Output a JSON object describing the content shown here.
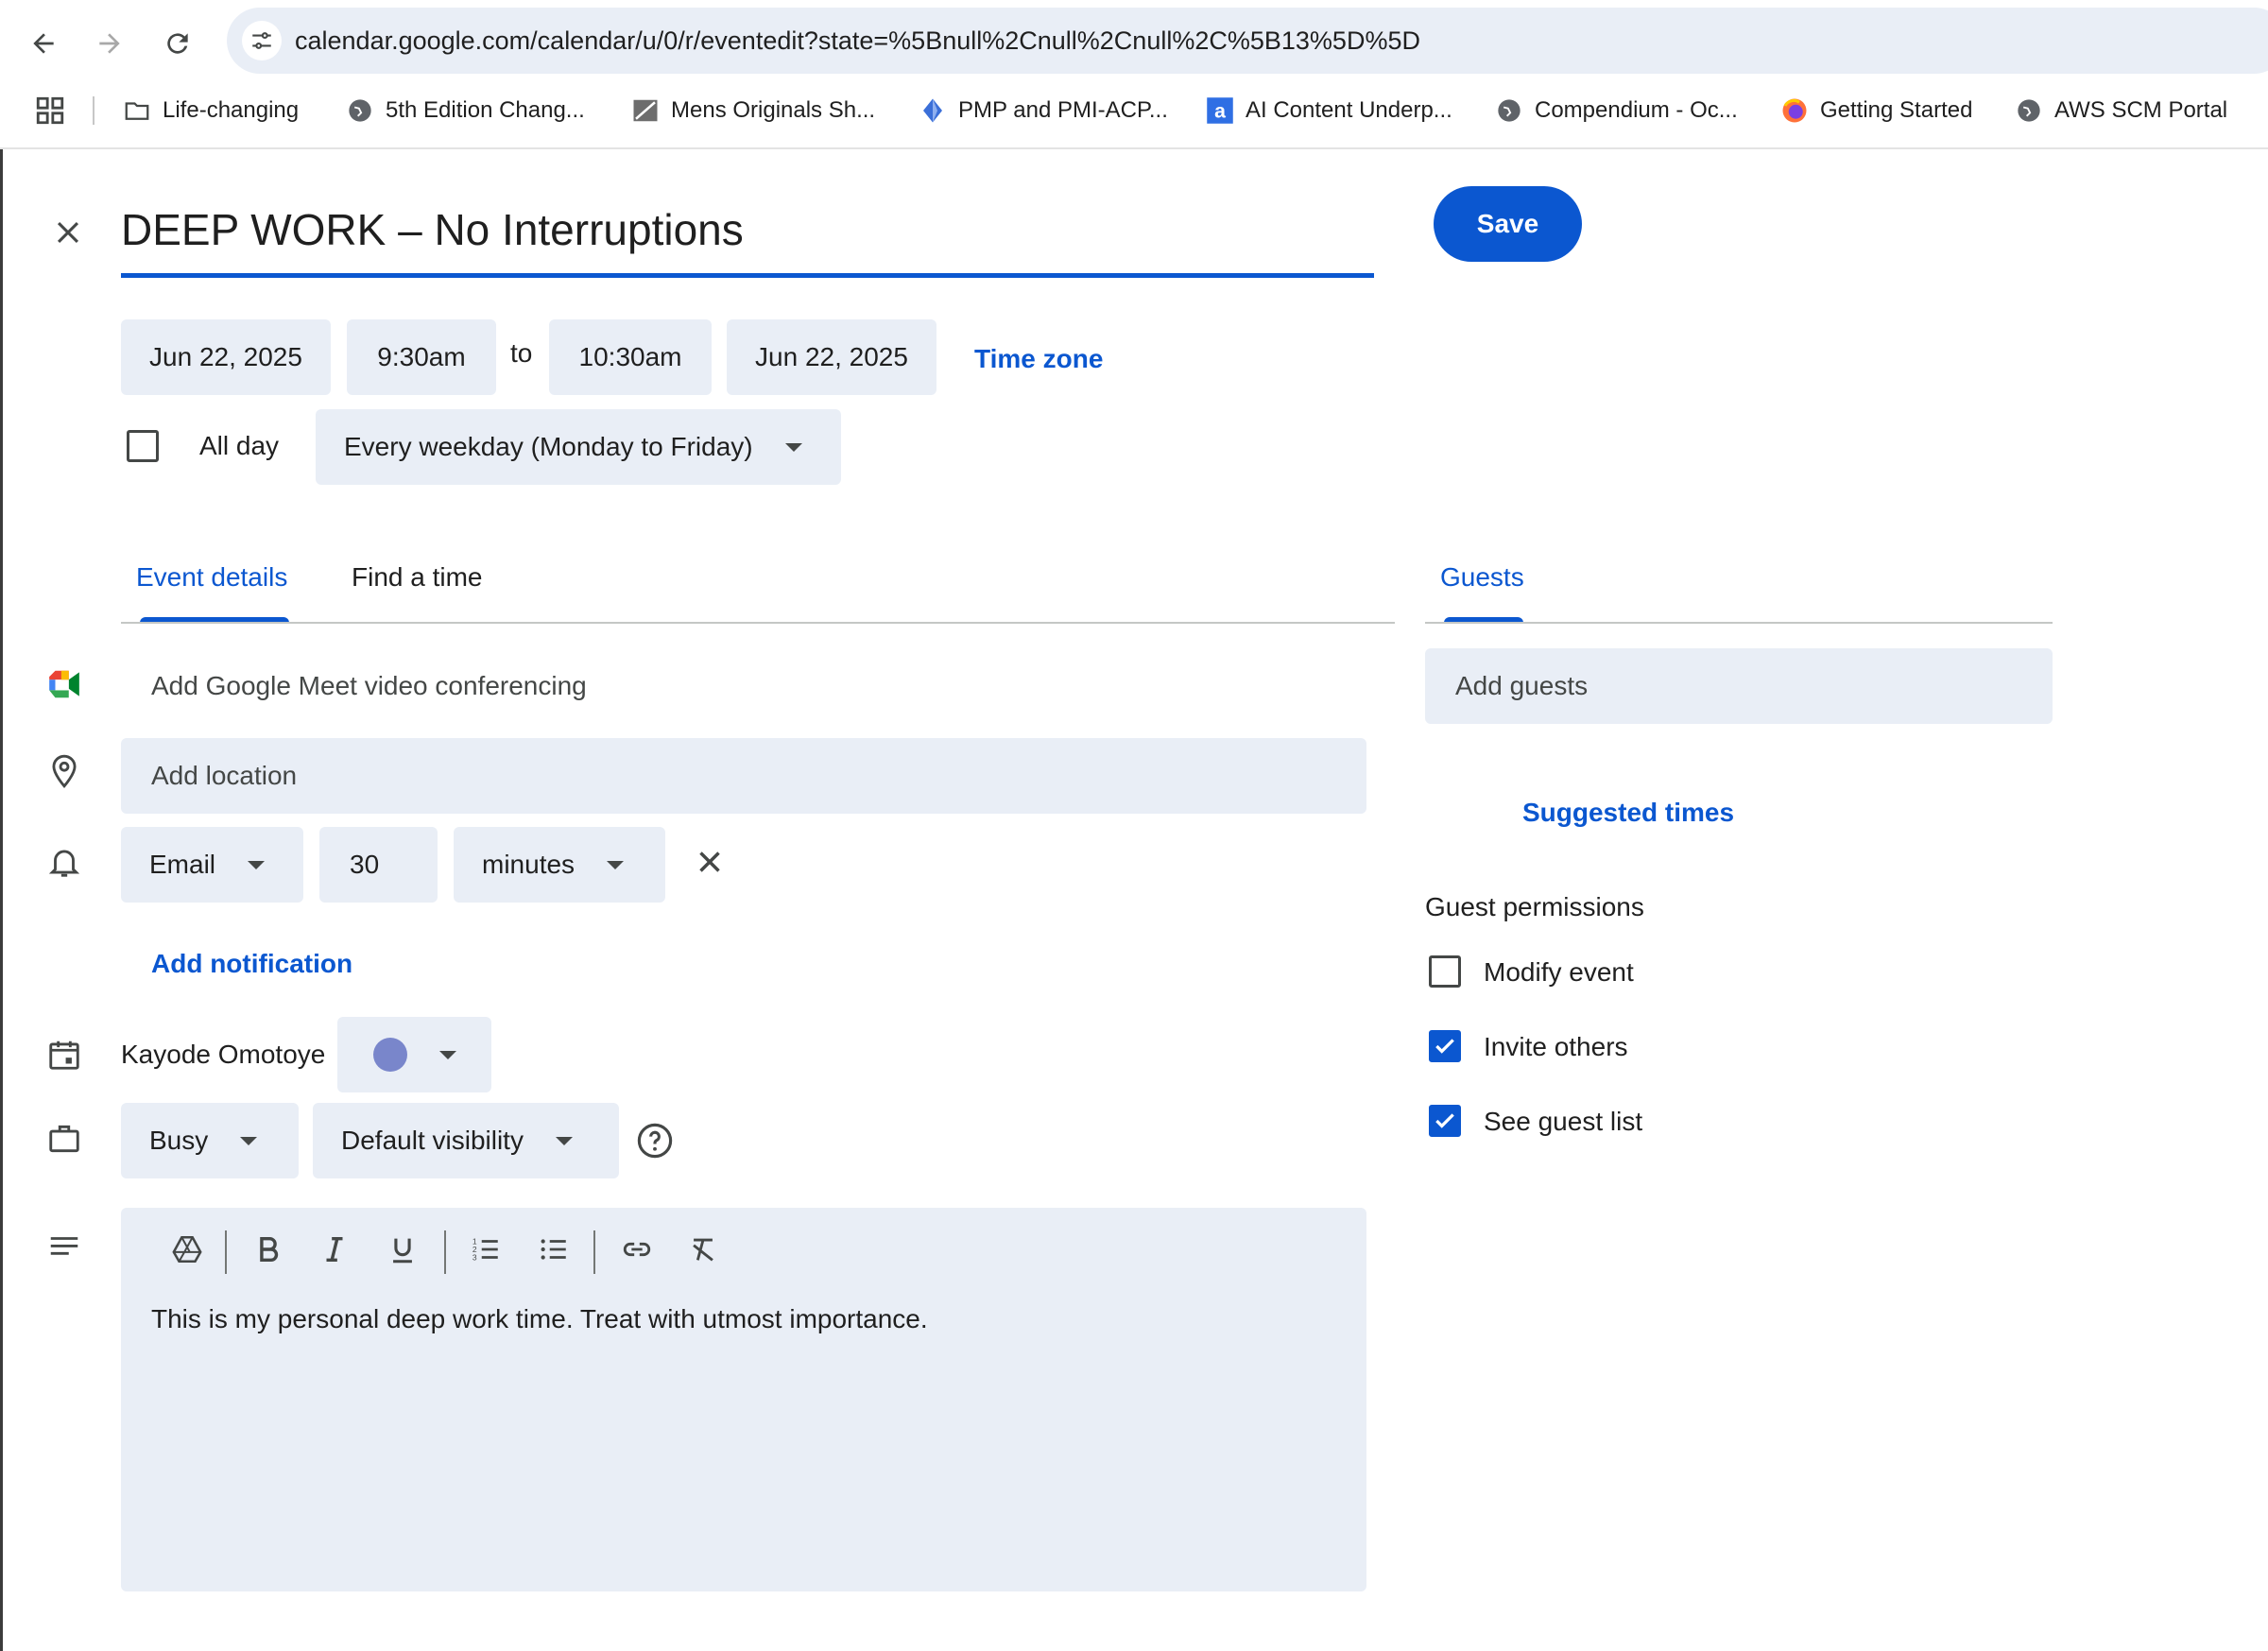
{
  "browser": {
    "url": "calendar.google.com/calendar/u/0/r/eventedit?state=%5Bnull%2Cnull%2Cnull%2C%5B13%5D%5D",
    "bookmarks": [
      {
        "label": "Life-changing",
        "icon": "folder-icon"
      },
      {
        "label": "5th Edition Chang...",
        "icon": "globe-icon"
      },
      {
        "label": "Mens Originals Sh...",
        "icon": "image-icon"
      },
      {
        "label": "PMP and PMI-ACP...",
        "icon": "gem-icon"
      },
      {
        "label": "AI Content Underp...",
        "icon": "amazon-icon"
      },
      {
        "label": "Compendium - Oc...",
        "icon": "globe-icon"
      },
      {
        "label": "Getting Started",
        "icon": "firefox-icon"
      },
      {
        "label": "AWS SCM Portal",
        "icon": "globe-icon"
      }
    ]
  },
  "event": {
    "title": "DEEP WORK – No Interruptions",
    "save_label": "Save",
    "start_date": "Jun 22, 2025",
    "start_time": "9:30am",
    "to_label": "to",
    "end_time": "10:30am",
    "end_date": "Jun 22, 2025",
    "time_zone_label": "Time zone",
    "all_day_label": "All day",
    "all_day_checked": false,
    "recurrence": "Every weekday (Monday to Friday)"
  },
  "tabs": {
    "event_details": "Event details",
    "find_a_time": "Find a time",
    "guests": "Guests"
  },
  "details": {
    "meet_label": "Add Google Meet video conferencing",
    "location_placeholder": "Add location",
    "notification": {
      "method": "Email",
      "amount": "30",
      "unit": "minutes"
    },
    "add_notification_label": "Add notification",
    "calendar_owner": "Kayode Omotoye",
    "calendar_color": "#7986cb",
    "availability": "Busy",
    "visibility": "Default visibility",
    "description": "This is my personal deep work time. Treat with utmost importance."
  },
  "guests": {
    "add_placeholder": "Add guests",
    "suggested_times_label": "Suggested times",
    "permissions_heading": "Guest permissions",
    "permissions": [
      {
        "label": "Modify event",
        "checked": false
      },
      {
        "label": "Invite others",
        "checked": true
      },
      {
        "label": "See guest list",
        "checked": true
      }
    ]
  },
  "colors": {
    "accent": "#0b57d0",
    "field_bg": "#e9eef6"
  }
}
